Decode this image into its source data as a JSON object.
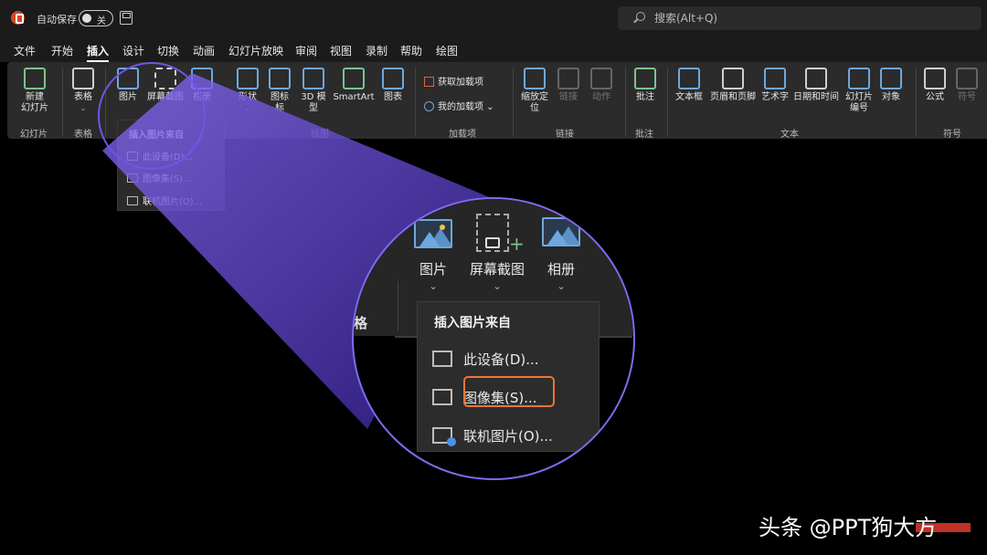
{
  "titlebar": {
    "autosave_label": "自动保存",
    "autosave_state": "关",
    "search_placeholder": "搜索(Alt+Q)"
  },
  "tabs": [
    "文件",
    "开始",
    "插入",
    "设计",
    "切换",
    "动画",
    "幻灯片放映",
    "审阅",
    "视图",
    "录制",
    "帮助",
    "绘图"
  ],
  "active_tab": "插入",
  "ribbon": {
    "new_slide": "新建",
    "new_slide_2": "幻灯片",
    "table": "表格",
    "picture": "图片",
    "screenshot": "屏幕截图",
    "album": "相册",
    "shapes": "形状",
    "icons": "图标",
    "icons_2": "标",
    "model3d": "3D 模",
    "model3d_2": "型",
    "smartart": "SmartArt",
    "chart": "图表",
    "get_addins": "获取加载项",
    "my_addins": "我的加载项",
    "zoom": "缩放定",
    "zoom_2": "位",
    "link": "链接",
    "action": "动作",
    "comment": "批注",
    "textbox": "文本框",
    "header_footer": "页眉和页脚",
    "wordart": "艺术字",
    "datetime": "日期和时间",
    "slide_number": "幻灯片",
    "slide_number_2": "编号",
    "object": "对象",
    "equation": "公式",
    "symbol": "符号",
    "groups": {
      "slides": "幻灯片",
      "tables": "表格",
      "illustrations": "插图",
      "addins": "加载项",
      "links": "链接",
      "comments": "批注",
      "text": "文本",
      "symbols": "符号"
    }
  },
  "dropdown": {
    "header": "插入图片来自",
    "items": [
      "此设备(D)...",
      "图像集(S)...",
      "联机图片(O)..."
    ]
  },
  "lens": {
    "picture": "图片",
    "screenshot": "屏幕截图",
    "album": "相册",
    "partial_label": "格",
    "menu_header": "插入图片来自",
    "items": [
      "此设备(D)...",
      "图像集(S)...",
      "联机图片(O)..."
    ]
  },
  "watermark": "头条 @PPT狗大方",
  "colors": {
    "accent_purple": "#7b5cf0",
    "highlight_orange": "#e8763a",
    "ribbon_bg": "#2b2b2b"
  }
}
